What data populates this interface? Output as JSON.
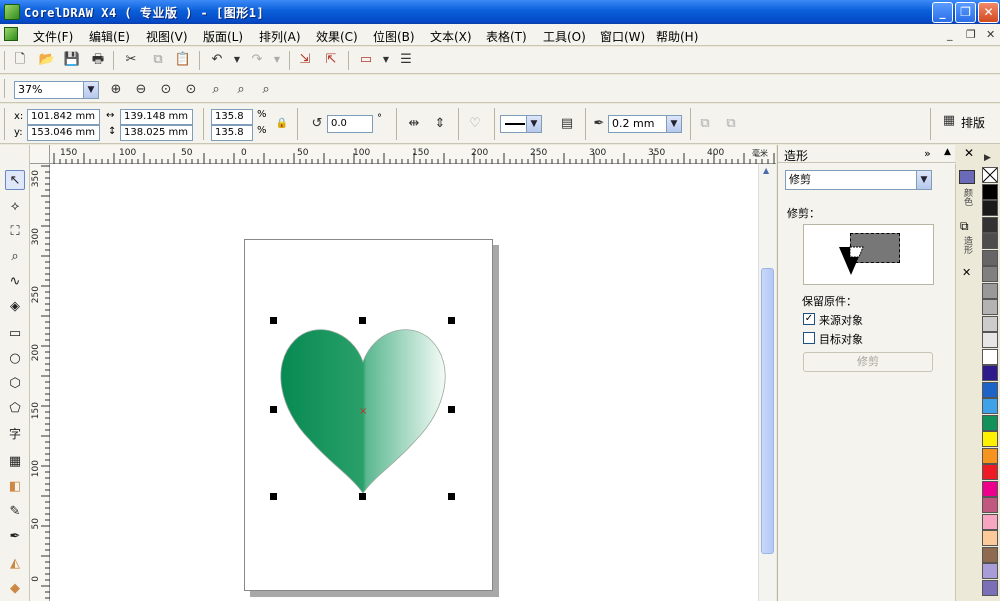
{
  "app": {
    "title": "CorelDRAW X4 ( 专业版 ) - [图形1]"
  },
  "menubar": {
    "items": [
      "文件(F)",
      "编辑(E)",
      "视图(V)",
      "版面(L)",
      "排列(A)",
      "效果(C)",
      "位图(B)",
      "文本(X)",
      "表格(T)",
      "工具(O)",
      "窗口(W)",
      "帮助(H)"
    ]
  },
  "zoom": {
    "value": "37%"
  },
  "property_bar": {
    "x_label": "x:",
    "x_value": "101.842 mm",
    "y_label": "y:",
    "y_value": "153.046 mm",
    "width_value": "139.148 mm",
    "height_value": "138.025 mm",
    "scale_x": "135.8",
    "scale_y": "135.8",
    "percent_x": "%",
    "percent_y": "%",
    "rotation": "0.0",
    "degree": "°",
    "outline_width": "0.2 mm",
    "arrange_label": "排版"
  },
  "ruler": {
    "h_ticks": [
      "150",
      "100",
      "50",
      "0",
      "50",
      "100",
      "150",
      "200",
      "250",
      "300",
      "350",
      "400"
    ],
    "h_unit": "毫米",
    "v_ticks": [
      "350",
      "300",
      "250",
      "200",
      "150",
      "100",
      "50",
      "0"
    ]
  },
  "docker": {
    "title": "造形",
    "mode_select": "修剪",
    "section_label": "修剪：",
    "keep_original_label": "保留原件：",
    "source_object_label": "来源对象",
    "target_object_label": "目标对象",
    "source_checked": true,
    "target_checked": false,
    "apply_button": "修剪",
    "side_tabs": [
      "颜色",
      "造形"
    ]
  },
  "palette": {
    "colors": [
      "#ffffff",
      "#000000",
      "#1a1a1a",
      "#333333",
      "#4d4d4d",
      "#666666",
      "#808080",
      "#999999",
      "#b3b3b3",
      "#cccccc",
      "#e6e6e6",
      "#ffffff",
      "#2e1a8a",
      "#1e63c8",
      "#3fa2e8",
      "#13915a",
      "#fff200",
      "#f7941d",
      "#ed1c24",
      "#ec008c",
      "#c1587f",
      "#f6a6c1",
      "#fbc99a",
      "#8d6a50",
      "#a89dd6",
      "#7b6fb8"
    ]
  },
  "colors": {
    "heart_dark": "#078a52",
    "heart_light": "#f4fbf7",
    "title_blue": "#0a5fd8",
    "selection_handle": "#000000"
  }
}
